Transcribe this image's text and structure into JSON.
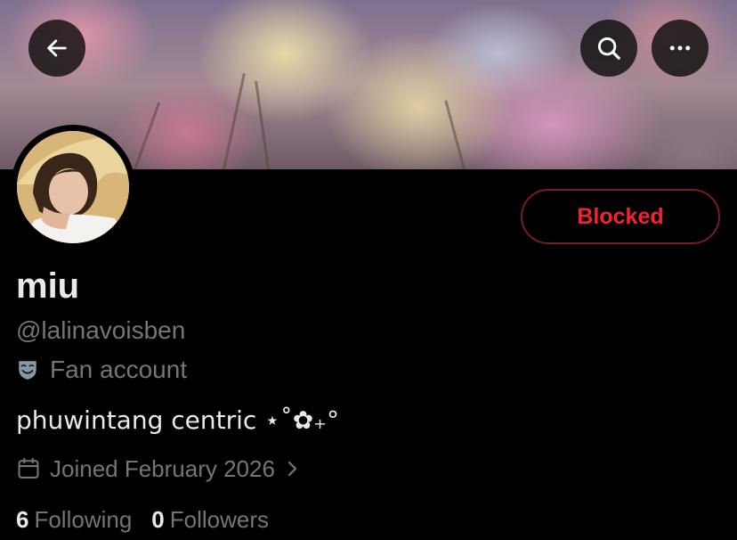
{
  "header": {
    "back_icon": "arrow-left-icon",
    "search_icon": "search-icon",
    "more_icon": "more-horizontal-icon"
  },
  "profile": {
    "display_name": "miu",
    "handle": "@lalinavoisben",
    "category": "Fan account",
    "category_icon": "theater-masks-icon",
    "bio": "phuwintang centric ⋆˚✿₊°",
    "joined": "Joined February 2026",
    "following_count": "6",
    "following_label": "Following",
    "followers_count": "0",
    "followers_label": "Followers"
  },
  "actions": {
    "blocked_label": "Blocked",
    "blocked_color": "#f4212e"
  },
  "colors": {
    "background": "#000000",
    "primary_text": "#e7e9ea",
    "secondary_text": "#71767b"
  }
}
